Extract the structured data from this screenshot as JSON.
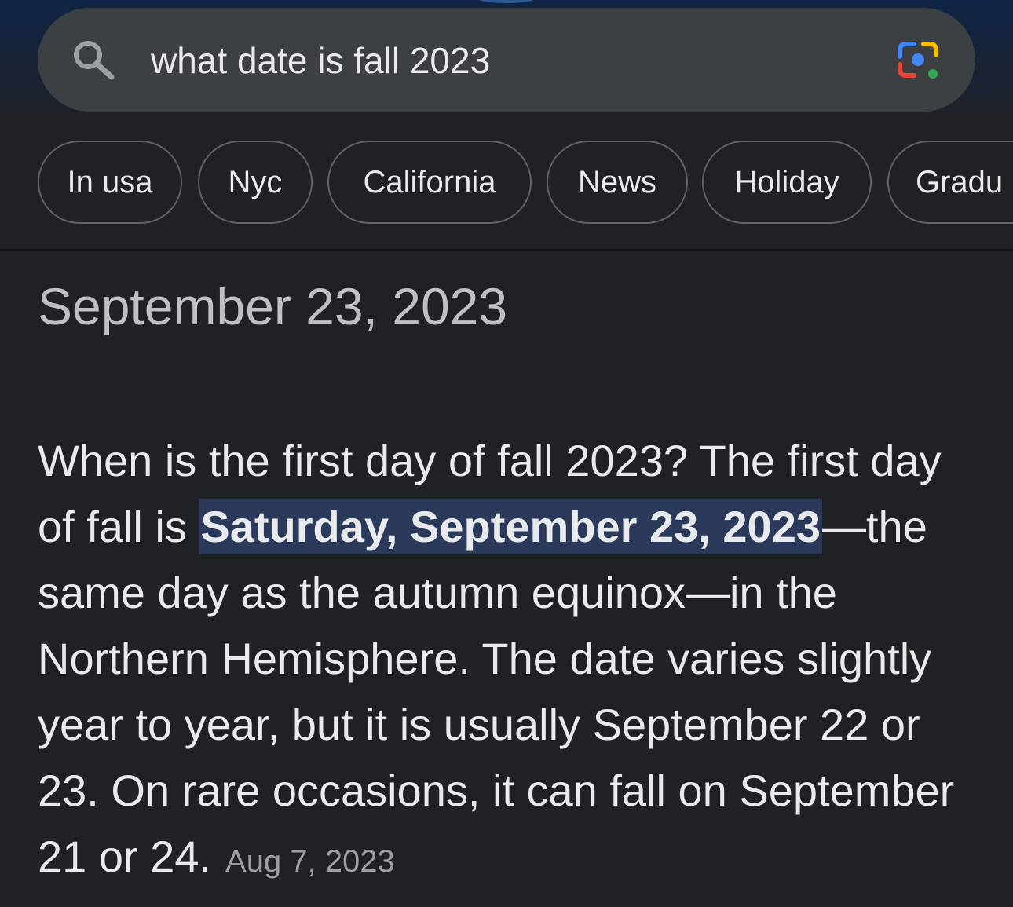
{
  "search": {
    "query": "what date is fall 2023"
  },
  "chips": [
    {
      "label": "In usa"
    },
    {
      "label": "Nyc"
    },
    {
      "label": "California"
    },
    {
      "label": "News"
    },
    {
      "label": "Holiday"
    },
    {
      "label": "Gradu"
    }
  ],
  "answer": {
    "title": "September 23, 2023",
    "text_before": "When is the first day of fall 2023? The first day of fall is ",
    "highlight": "Saturday, September 23, 2023",
    "text_after": "—the same day as the autumn equinox—in the Northern Hemisphere. The date varies slightly year to year, but it is usually September 22 or 23. On rare occasions, it can fall on September 21 or 24.",
    "date": "Aug 7, 2023"
  },
  "colors": {
    "background": "#202124",
    "search_bar": "#3c4043",
    "chip_border": "#5f6368",
    "highlight_bg": "#2b3a5a",
    "text": "#e8eaed",
    "muted_text": "#9aa0a6"
  }
}
